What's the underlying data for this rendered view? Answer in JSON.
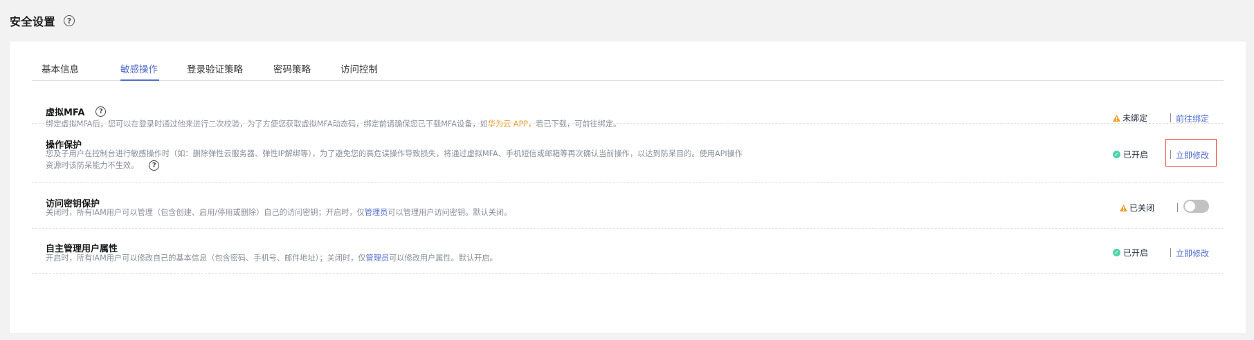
{
  "page": {
    "title": "安全设置",
    "help_glyph": "?"
  },
  "tabs": [
    {
      "label": "基本信息",
      "active": false
    },
    {
      "label": "敏感操作",
      "active": true
    },
    {
      "label": "登录验证策略",
      "active": false
    },
    {
      "label": "密码策略",
      "active": false
    },
    {
      "label": "访问控制",
      "active": false
    }
  ],
  "rows": {
    "mfa": {
      "title": "虚拟MFA",
      "desc_before": "绑定虚拟MFA后，您可以在登录时通过他来进行二次校验，为了方便您获取虚拟MFA动态码，绑定前请确保您已下载MFA设备，如",
      "desc_link": "华为云 APP，",
      "desc_after": "若已下载，可前往绑定。",
      "status": "未绑定",
      "status_icon": "warning-icon",
      "action": "前往绑定"
    },
    "op_protect": {
      "title": "操作保护",
      "desc_line1": "您及子用户在控制台进行敏感操作时（如：删除弹性云服务器、弹性IP解绑等），为了避免您的高危误操作导致损失，将通过虚拟MFA、手机短信或邮箱等再次确认当前操作，以达到防呆目的。使用API操作",
      "desc_line2": "资源时该防呆能力不生效。",
      "status": "已开启",
      "status_icon": "check-circle-icon",
      "action": "立即修改"
    },
    "access_key": {
      "title": "访问密钥保护",
      "desc_before": "关闭时，所有IAM用户可以管理（包含创建、启用/停用或删除）自己的访问密钥；开启时，仅",
      "desc_link": "管理员",
      "desc_after": "可以管理用户访问密钥。默认关闭。",
      "status": "已关闭",
      "status_icon": "warning-icon",
      "toggle_on": false
    },
    "self_manage": {
      "title": "自主管理用户属性",
      "desc_before": "开启时，所有IAM用户可以修改自己的基本信息（包含密码、手机号、邮件地址）；关闭时，仅",
      "desc_link": "管理员",
      "desc_after": "可以修改用户属性。默认开启。",
      "status": "已开启",
      "status_icon": "check-circle-icon",
      "action": "立即修改"
    }
  },
  "colors": {
    "accent": "#526ecc",
    "warning": "#f09c23",
    "success": "#50d4ab",
    "highlight_box": "#e84a46"
  }
}
